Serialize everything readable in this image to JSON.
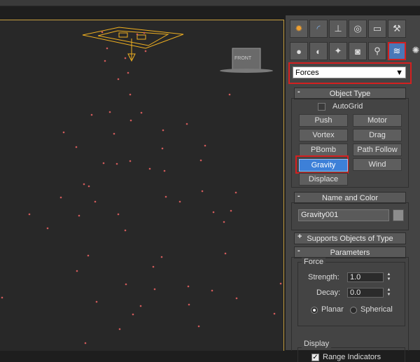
{
  "command_panel": {
    "main_tabs": [
      {
        "icon": "create-star-icon"
      },
      {
        "icon": "modify-curve-icon"
      },
      {
        "icon": "hierarchy-icon"
      },
      {
        "icon": "motion-icon"
      },
      {
        "icon": "display-monitor-icon"
      },
      {
        "icon": "utilities-hammer-icon"
      }
    ],
    "sub_tabs": [
      {
        "icon": "geometry-sphere-icon"
      },
      {
        "icon": "shapes-icon"
      },
      {
        "icon": "lights-icon"
      },
      {
        "icon": "cameras-icon"
      },
      {
        "icon": "helpers-icon"
      },
      {
        "icon": "space-warps-icon",
        "active": true
      },
      {
        "icon": "systems-gear-icon"
      }
    ],
    "category_dropdown": {
      "value": "Forces"
    },
    "object_type": {
      "title": "Object Type",
      "autogrid_label": "AutoGrid",
      "buttons": [
        "Push",
        "Motor",
        "Vortex",
        "Drag",
        "PBomb",
        "Path Follow",
        "Gravity",
        "Wind",
        "Displace"
      ],
      "active_button": "Gravity"
    },
    "name_color": {
      "title": "Name and Color",
      "name_value": "Gravity001",
      "color": "#8c8c8c"
    },
    "supports": {
      "title": "Supports Objects of Type"
    },
    "parameters": {
      "title": "Parameters",
      "force_group": "Force",
      "strength_label": "Strength:",
      "strength_value": "1.0",
      "decay_label": "Decay:",
      "decay_value": "0.0",
      "planar_label": "Planar",
      "spherical_label": "Spherical",
      "display_group": "Display",
      "range_indicators_label": "Range Indicators"
    }
  },
  "viewport": {
    "gizmo_label": "FRONT"
  },
  "colors": {
    "accent": "#d42020",
    "selection": "#3d80d8",
    "gizmo": "#f0b020",
    "particle": "#d05a5a"
  }
}
